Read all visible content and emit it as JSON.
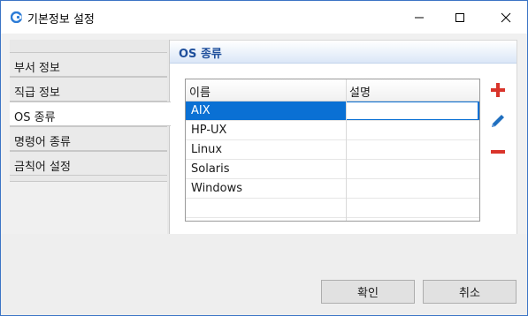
{
  "window": {
    "title": "기본정보 설정"
  },
  "sidebar": {
    "items": [
      {
        "label": "부서 정보"
      },
      {
        "label": "직급 정보"
      },
      {
        "label": "OS 종류"
      },
      {
        "label": "명령어 종류"
      },
      {
        "label": "금칙어 설정"
      }
    ],
    "active_index": 2
  },
  "panel": {
    "title": "OS 종류",
    "columns": [
      "이름",
      "설명"
    ],
    "rows": [
      {
        "name": "AIX",
        "desc": ""
      },
      {
        "name": "HP-UX",
        "desc": ""
      },
      {
        "name": "Linux",
        "desc": ""
      },
      {
        "name": "Solaris",
        "desc": ""
      },
      {
        "name": "Windows",
        "desc": ""
      }
    ],
    "selected_row": 0
  },
  "actions": {
    "add_icon": "plus-icon",
    "edit_icon": "pencil-icon",
    "remove_icon": "minus-icon"
  },
  "buttons": {
    "ok": "확인",
    "cancel": "취소"
  },
  "colors": {
    "accent": "#0a70d4",
    "title_text": "#1f4f9c",
    "action_red": "#d9342b",
    "action_blue": "#1f6fbf"
  }
}
